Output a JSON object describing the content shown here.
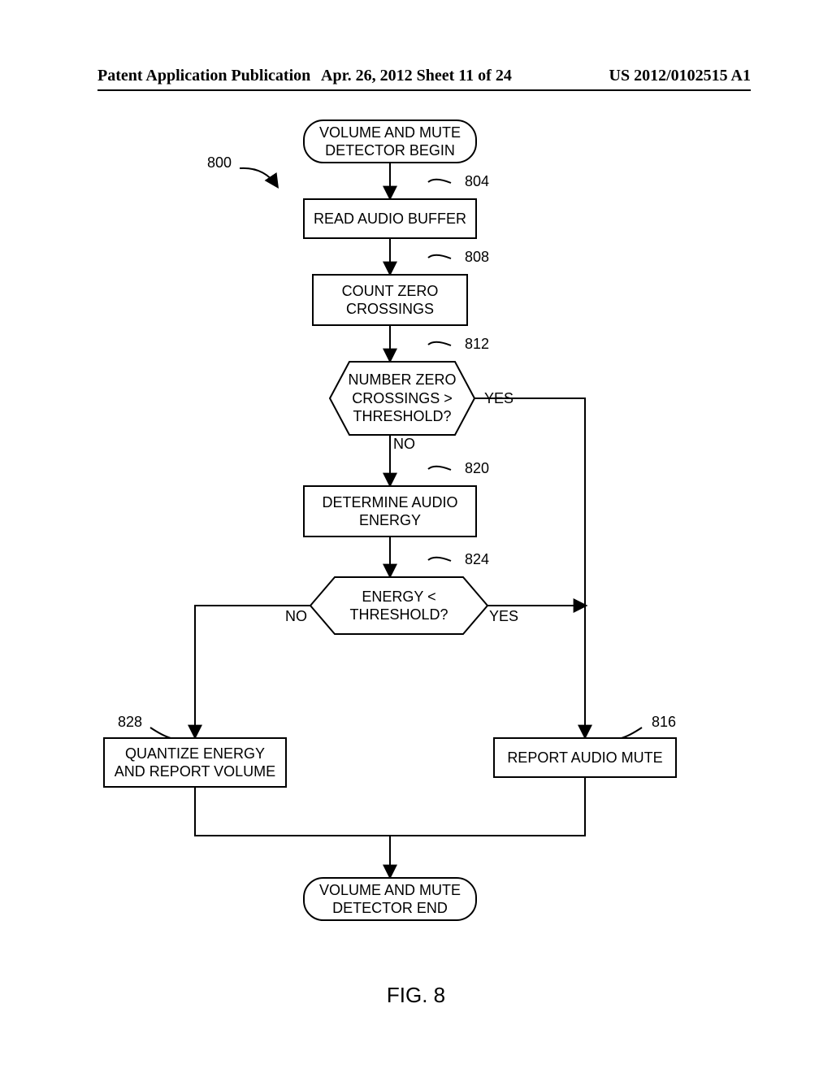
{
  "header": {
    "left": "Patent Application Publication",
    "center": "Apr. 26, 2012  Sheet 11 of 24",
    "right": "US 2012/0102515 A1"
  },
  "flow": {
    "ref": "800",
    "start": "VOLUME AND MUTE\nDETECTOR BEGIN",
    "step804": {
      "num": "804",
      "label": "READ AUDIO BUFFER"
    },
    "step808": {
      "num": "808",
      "label": "COUNT ZERO\nCROSSINGS"
    },
    "dec812": {
      "num": "812",
      "label": "NUMBER ZERO\nCROSSINGS >\nTHRESHOLD?",
      "yes": "YES",
      "no": "NO"
    },
    "step820": {
      "num": "820",
      "label": "DETERMINE AUDIO\nENERGY"
    },
    "dec824": {
      "num": "824",
      "label": "ENERGY <\nTHRESHOLD?",
      "yes": "YES",
      "no": "NO"
    },
    "step828": {
      "num": "828",
      "label": "QUANTIZE ENERGY\nAND REPORT VOLUME"
    },
    "step816": {
      "num": "816",
      "label": "REPORT AUDIO MUTE"
    },
    "end": "VOLUME AND MUTE\nDETECTOR END"
  },
  "figure": "FIG. 8"
}
